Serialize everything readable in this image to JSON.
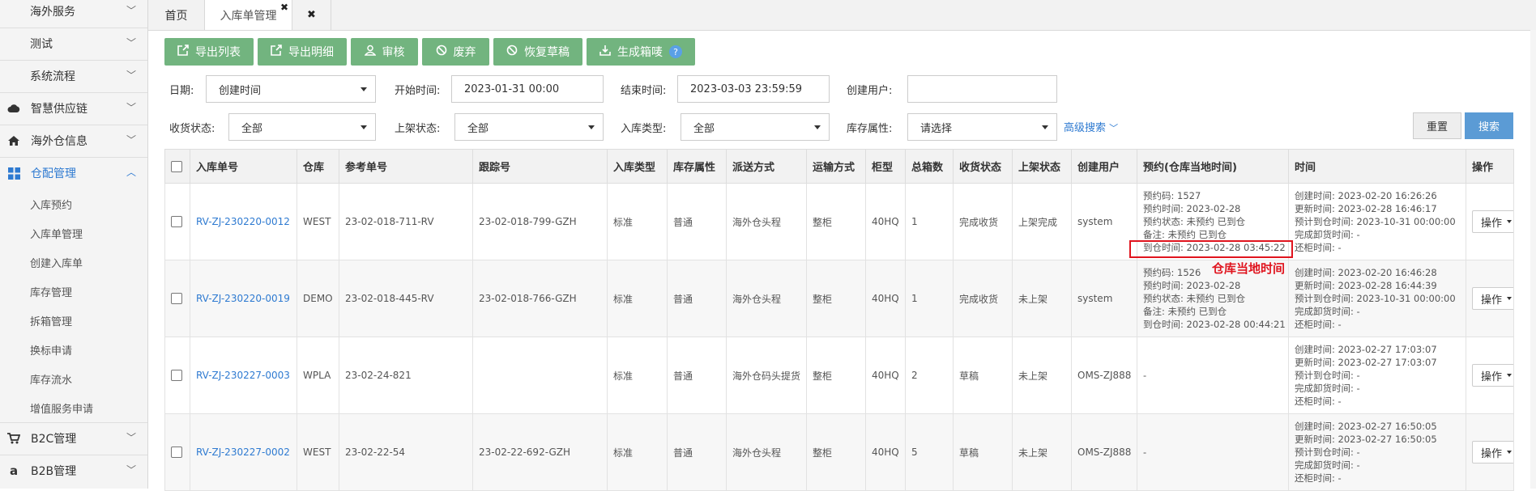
{
  "sidebar": {
    "sub_top": [
      {
        "label": "海外服务"
      },
      {
        "label": "测试"
      },
      {
        "label": "系统流程"
      }
    ],
    "top": [
      {
        "label": "智慧供应链",
        "icon": "cloud-icon"
      },
      {
        "label": "海外仓信息",
        "icon": "home-icon"
      },
      {
        "label": "仓配管理",
        "icon": "grid-icon"
      }
    ],
    "children": [
      {
        "label": "入库预约"
      },
      {
        "label": "入库单管理"
      },
      {
        "label": "创建入库单"
      },
      {
        "label": "库存管理"
      },
      {
        "label": "拆箱管理"
      },
      {
        "label": "换标申请"
      },
      {
        "label": "库存流水"
      },
      {
        "label": "增值服务申请"
      }
    ],
    "bottom": [
      {
        "label": "B2C管理",
        "icon": "cart-icon"
      },
      {
        "label": "B2B管理",
        "icon": "amazon-icon"
      }
    ]
  },
  "tabs": {
    "home": "首页",
    "inbound": "入库单管理",
    "close_glyph": "✖"
  },
  "toolbar": {
    "export_list": "导出列表",
    "export_detail": "导出明细",
    "audit": "审核",
    "discard": "废弃",
    "restore_draft": "恢复草稿",
    "gen_label": "生成箱唛",
    "help_glyph": "?"
  },
  "filters": {
    "date_label": "日期:",
    "date_value": "创建时间",
    "start_label": "开始时间:",
    "start_value": "2023-01-31 00:00",
    "end_label": "结束时间:",
    "end_value": "2023-03-03 23:59:59",
    "user_label": "创建用户:",
    "user_value": "",
    "receive_label": "收货状态:",
    "receive_value": "全部",
    "shelf_label": "上架状态:",
    "shelf_value": "全部",
    "type_label": "入库类型:",
    "type_value": "全部",
    "attr_label": "库存属性:",
    "attr_value": "请选择",
    "advanced": "高级搜索",
    "reset": "重置",
    "search": "搜索"
  },
  "table": {
    "headers": [
      "入库单号",
      "仓库",
      "参考单号",
      "跟踪号",
      "入库类型",
      "库存属性",
      "派送方式",
      "运输方式",
      "柜型",
      "总箱数",
      "收货状态",
      "上架状态",
      "创建用户",
      "预约(仓库当地时间)",
      "时间",
      "操作"
    ],
    "rows": [
      {
        "num": "RV-ZJ-230220-0012",
        "wh": "WEST",
        "ref": "23-02-018-711-RV",
        "track": "23-02-018-799-GZH",
        "type": "标准",
        "attr": "普通",
        "delivery": "海外仓头程",
        "transport": "整柜",
        "cabinet": "40HQ",
        "boxes": "1",
        "recv": "完成收货",
        "shelf": "上架完成",
        "user": "system",
        "appt": [
          "预约码: 1527",
          "预约时间: 2023-02-28",
          "预约状态: 未预约 已到仓",
          "备注: 未预约 已到仓",
          "到仓时间: 2023-02-28 03:45:22"
        ],
        "time": [
          "创建时间: 2023-02-20 16:26:26",
          "更新时间: 2023-02-28 16:46:17",
          "预计到仓时间: 2023-10-31 00:00:00",
          "完成卸货时间: -",
          "还柜时间: -"
        ],
        "op": "操作"
      },
      {
        "num": "RV-ZJ-230220-0019",
        "wh": "DEMO",
        "ref": "23-02-018-445-RV",
        "track": "23-02-018-766-GZH",
        "type": "标准",
        "attr": "普通",
        "delivery": "海外仓头程",
        "transport": "整柜",
        "cabinet": "40HQ",
        "boxes": "1",
        "recv": "完成收货",
        "shelf": "未上架",
        "user": "system",
        "appt": [
          "预约码: 1526",
          "预约时间: 2023-02-28",
          "预约状态: 未预约 已到仓",
          "备注: 未预约 已到仓",
          "到仓时间: 2023-02-28 00:44:21"
        ],
        "time": [
          "创建时间: 2023-02-20 16:46:28",
          "更新时间: 2023-02-28 16:44:39",
          "预计到仓时间: 2023-10-31 00:00:00",
          "完成卸货时间: -",
          "还柜时间: -"
        ],
        "op": "操作"
      },
      {
        "num": "RV-ZJ-230227-0003",
        "wh": "WPLA",
        "ref": "23-02-24-821",
        "track": "",
        "type": "标准",
        "attr": "普通",
        "delivery": "海外仓码头提货",
        "transport": "整柜",
        "cabinet": "40HQ",
        "boxes": "2",
        "recv": "草稿",
        "shelf": "未上架",
        "user": "OMS-ZJ888",
        "appt": [
          "-"
        ],
        "time": [
          "创建时间: 2023-02-27 17:03:07",
          "更新时间: 2023-02-27 17:03:07",
          "预计到仓时间: -",
          "完成卸货时间: -",
          "还柜时间: -"
        ],
        "op": "操作"
      },
      {
        "num": "RV-ZJ-230227-0002",
        "wh": "WEST",
        "ref": "23-02-22-54",
        "track": "23-02-22-692-GZH",
        "type": "标准",
        "attr": "普通",
        "delivery": "海外仓头程",
        "transport": "整柜",
        "cabinet": "40HQ",
        "boxes": "5",
        "recv": "草稿",
        "shelf": "未上架",
        "user": "OMS-ZJ888",
        "appt": [
          "-"
        ],
        "time": [
          "创建时间: 2023-02-27 16:50:05",
          "更新时间: 2023-02-27 16:50:05",
          "预计到仓时间: -",
          "完成卸货时间: -",
          "还柜时间: -"
        ],
        "op": "操作"
      }
    ]
  },
  "annotation": "仓库当地时间",
  "colors": {
    "accent": "#2e7ad1",
    "toolbar_green": "#72b47f",
    "search_blue": "#5b9bd5",
    "highlight_red": "#e0141e"
  }
}
